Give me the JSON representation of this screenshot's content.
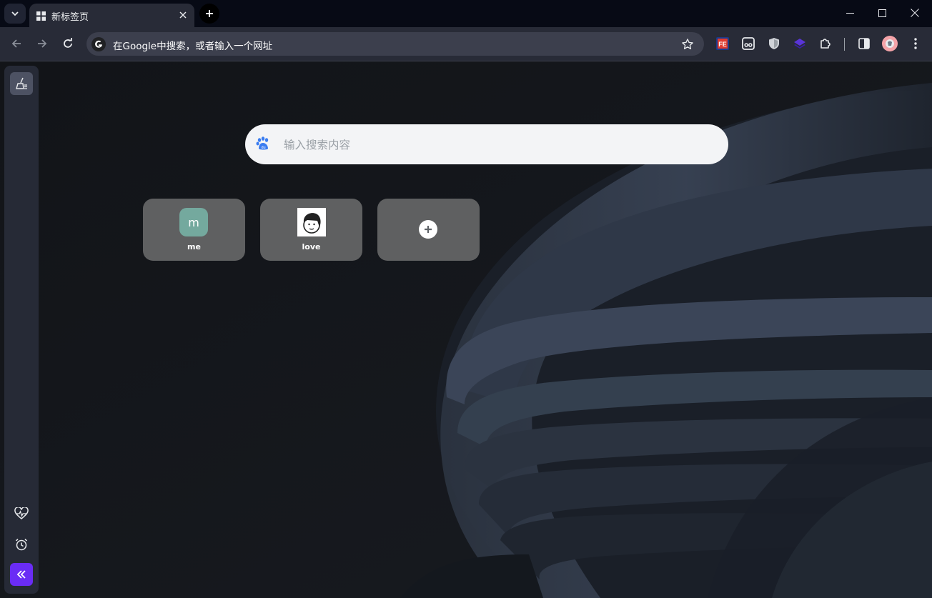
{
  "tab": {
    "title": "新标签页",
    "icon": "grid-icon"
  },
  "omnibox": {
    "placeholder": "在Google中搜索，或者输入一个网址"
  },
  "extensions": [
    "fe-helper-icon",
    "tampermonkey-icon",
    "shield-icon",
    "layers-icon",
    "puzzle-icon"
  ],
  "search": {
    "placeholder": "输入搜索内容",
    "engine_icon": "baidu-paw-icon"
  },
  "shortcuts": [
    {
      "label": "me",
      "icon_letter": "m"
    },
    {
      "label": "love",
      "icon": "cartoon-avatar-icon"
    },
    {
      "label": "",
      "icon": "add-icon"
    }
  ],
  "sidebar": {
    "top": [
      "broom-icon"
    ],
    "bottom": [
      "heart-pulse-icon",
      "alarm-clock-icon",
      "collapse-icon"
    ]
  },
  "colors": {
    "accent": "#6a2cf5",
    "tile_letter_bg": "#74a99e"
  }
}
